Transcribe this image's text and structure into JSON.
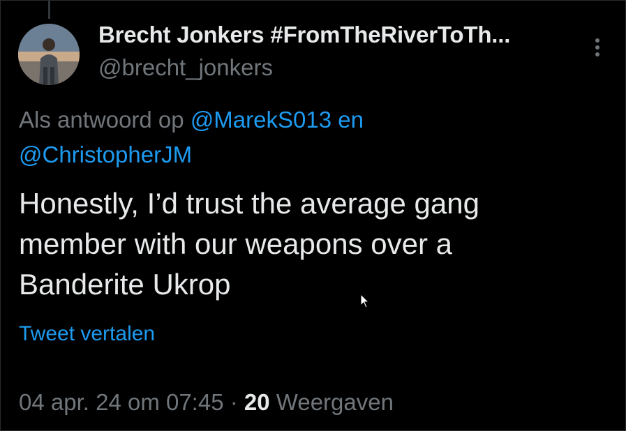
{
  "tweet": {
    "author": {
      "display_name": "Brecht Jonkers #FromTheRiverToTh...",
      "handle": "@brecht_jonkers"
    },
    "reply_context": {
      "prefix": "Als antwoord op",
      "mention_1": "@MarekS013",
      "conjunction": "en",
      "mention_2": "@ChristopherJM"
    },
    "text_lines": [
      "Honestly, I’d trust the average gang",
      "member with our weapons over a",
      "Banderite Ukrop"
    ],
    "translate_label": "Tweet vertalen",
    "timestamp": "04 apr. 24 om 07:45",
    "separator": "·",
    "views_count": "20",
    "views_label": "Weergaven"
  },
  "icons": {
    "more": "more-vertical-icon",
    "cursor": "mouse-pointer-icon"
  },
  "colors": {
    "background": "#000000",
    "text_primary": "#e7e9ea",
    "text_secondary": "#71767b",
    "link": "#1d9bf0"
  }
}
